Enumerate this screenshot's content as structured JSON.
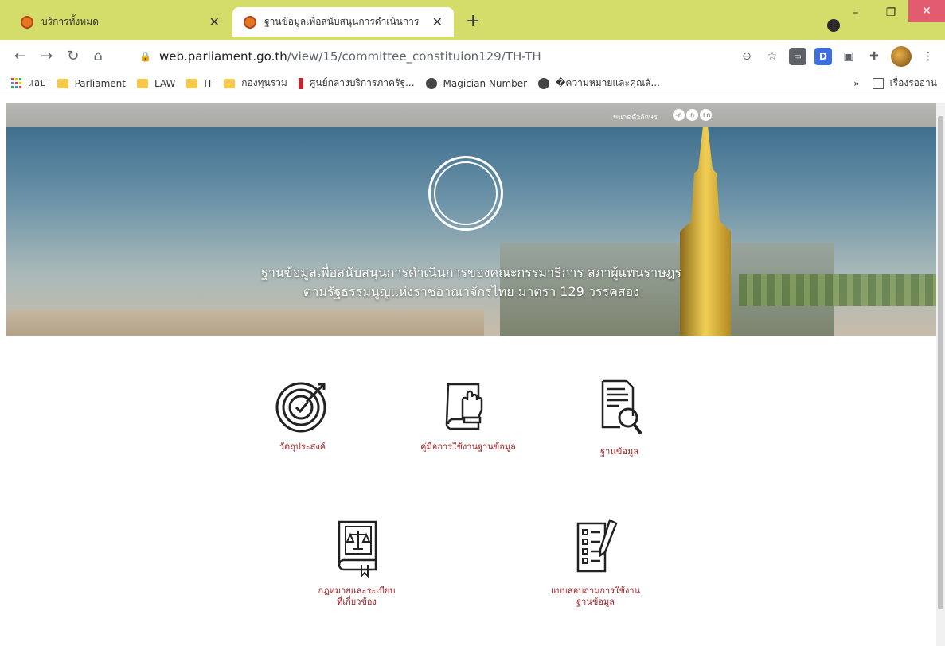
{
  "browser": {
    "tabs": [
      {
        "title": "บริการทั้งหมด",
        "active": false
      },
      {
        "title": "ฐานข้อมูลเพื่อสนับสนุนการดำเนินการ",
        "active": true
      }
    ],
    "url_host": "web.parliament.go.th",
    "url_path": "/view/15/committee_constituion129/TH-TH",
    "bookmarks": [
      "แอป",
      "Parliament",
      "LAW",
      "IT",
      "กองทุนรวม",
      "ศูนย์กลางบริการภาครัฐ...",
      "Magician Number",
      "�ความหมายและคุณลั..."
    ],
    "bookmarks_overflow": "»",
    "reading_list": "เรื่องรออ่าน",
    "accent_color": "#d4dd6a"
  },
  "page": {
    "font_size_label": "ขนาดตัวอักษร",
    "font_buttons": [
      "-ก",
      "ก",
      "+ก"
    ],
    "hero_line1": "ฐานข้อมูลเพื่อสนับสนุนการดำเนินการของคณะกรรมาธิการ สภาผู้แทนราษฎร",
    "hero_line2": "ตามรัฐธรรมนูญแห่งราชอาณาจักรไทย มาตรา 129 วรรคสอง",
    "menu": [
      {
        "label": "วัตถุประสงค์",
        "icon": "target-icon"
      },
      {
        "label": "คู่มือการใช้งานฐานข้อมูล",
        "icon": "manual-book-icon"
      },
      {
        "label": "ฐานข้อมูล",
        "icon": "document-search-icon"
      },
      {
        "label": "กฎหมายและระเบียบ",
        "label2": "ที่เกี่ยวข้อง",
        "icon": "law-book-icon"
      },
      {
        "label": "แบบสอบถามการใช้งาน",
        "label2": "ฐานข้อมูล",
        "icon": "survey-icon"
      }
    ],
    "menu_color": "#a01e22"
  }
}
